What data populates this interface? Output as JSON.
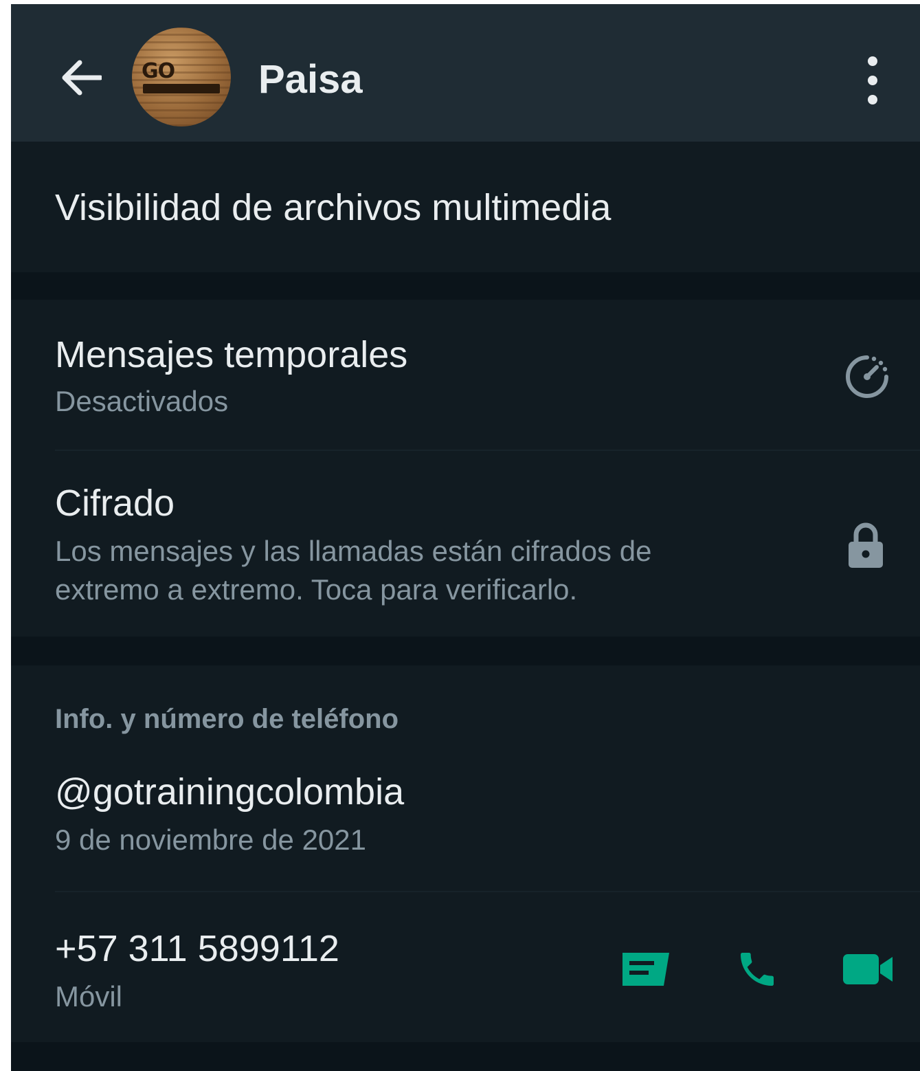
{
  "header": {
    "contact_name": "Paisa",
    "avatar_logo_text": "GO"
  },
  "media_visibility": {
    "label": "Visibilidad de archivos multimedia"
  },
  "disappearing_messages": {
    "label": "Mensajes temporales",
    "status": "Desactivados"
  },
  "encryption": {
    "label": "Cifrado",
    "description_line1": "Los mensajes y las llamadas están cifrados de",
    "description_line2": "extremo a extremo. Toca para verificarlo."
  },
  "about_phone": {
    "section_label": "Info. y número de teléfono",
    "about_text": "@gotrainingcolombia",
    "about_date": "9 de noviembre de 2021",
    "phone_number": "+57 311 5899112",
    "phone_type": "Móvil"
  },
  "colors": {
    "background": "#111b21",
    "header": "#1f2c34",
    "accent": "#00a884",
    "primary_text": "#e9edef",
    "secondary_text": "#8696a0"
  },
  "icons": [
    "back-arrow-icon",
    "more-vert-icon",
    "timer-icon",
    "lock-icon",
    "message-icon",
    "phone-icon",
    "video-call-icon"
  ]
}
